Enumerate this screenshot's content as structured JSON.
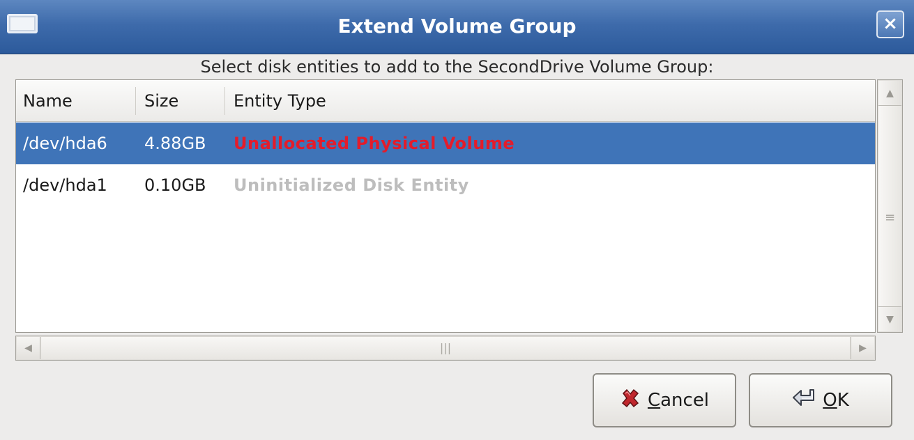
{
  "window": {
    "title": "Extend Volume Group",
    "close_glyph": "×"
  },
  "prompt": "Select disk entities to add to the SecondDrive Volume Group:",
  "table": {
    "columns": [
      "Name",
      "Size",
      "Entity Type"
    ],
    "rows": [
      {
        "name": "/dev/hda6",
        "size": "4.88GB",
        "type": "Unallocated Physical Volume",
        "type_color": "#e31c2b",
        "selected": true
      },
      {
        "name": "/dev/hda1",
        "size": "0.10GB",
        "type": "Uninitialized Disk Entity",
        "type_color": "#bdbdbd",
        "selected": false
      }
    ]
  },
  "buttons": {
    "cancel": {
      "mnemonic": "C",
      "rest": "ancel",
      "icon": "x-icon"
    },
    "ok": {
      "mnemonic": "O",
      "rest": "K",
      "icon": "enter-arrow-icon"
    }
  },
  "colors": {
    "selection": "#3f74b8",
    "titlebar": "#3e6bab"
  }
}
